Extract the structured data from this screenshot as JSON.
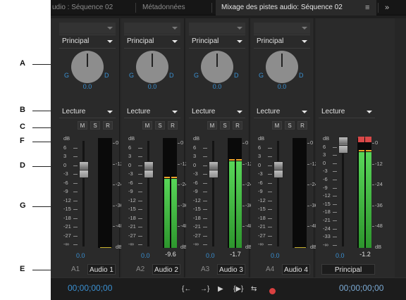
{
  "tabs": [
    {
      "label": "udio : Séquence 02"
    },
    {
      "label": "Métadonnées"
    },
    {
      "label": "Mixage des pistes audio: Séquence 02"
    }
  ],
  "tab_menu_glyph": "≡",
  "tab_overflow_glyph": "»",
  "annotations": [
    "A",
    "B",
    "C",
    "F",
    "D",
    "G",
    "E"
  ],
  "tracks": [
    {
      "output": "Principal",
      "mode": "Lecture",
      "pan_left": "G",
      "pan_right": "D",
      "pan_value": "0.0",
      "mute": "M",
      "solo": "S",
      "record": "R",
      "fader_db": "0.0",
      "peak": "",
      "id": "A1",
      "name": "Audio 1",
      "meter_level": 0.0
    },
    {
      "output": "Principal",
      "mode": "Lecture",
      "pan_left": "G",
      "pan_right": "D",
      "pan_value": "0.0",
      "mute": "M",
      "solo": "S",
      "record": "R",
      "fader_db": "0.0",
      "peak": "-9.6",
      "id": "A2",
      "name": "Audio 2",
      "meter_level": 0.63
    },
    {
      "output": "Principal",
      "mode": "Lecture",
      "pan_left": "G",
      "pan_right": "D",
      "pan_value": "0.0",
      "mute": "M",
      "solo": "S",
      "record": "R",
      "fader_db": "0.0",
      "peak": "-1.7",
      "id": "A3",
      "name": "Audio 3",
      "meter_level": 0.79
    },
    {
      "output": "Principal",
      "mode": "Lecture",
      "pan_left": "G",
      "pan_right": "D",
      "pan_value": "0.0",
      "mute": "M",
      "solo": "S",
      "record": "R",
      "fader_db": "0.0",
      "peak": "",
      "id": "A4",
      "name": "Audio 4",
      "meter_level": 0.0
    }
  ],
  "master": {
    "mode": "Lecture",
    "fader_db": "0.0",
    "peak": "-1.2",
    "name": "Principal",
    "meter_level": 0.87
  },
  "fader_scale": [
    "dB",
    "6",
    "3",
    "0",
    "-3",
    "-6",
    "-9",
    "-12",
    "-15",
    "-18",
    "-21",
    "-27",
    "-∞"
  ],
  "master_fader_scale": [
    "dB",
    "6",
    "3",
    "0",
    "-3",
    "-6",
    "-9",
    "-12",
    "-15",
    "-18",
    "-21",
    "-24",
    "-33",
    "-∞"
  ],
  "meter_scale": [
    "0",
    "-12",
    "-24",
    "-36",
    "-48",
    "dB"
  ],
  "transport": {
    "timecode_left": "00;00;00;00",
    "timecode_right": "00;00;00;00",
    "buttons": [
      "{←",
      "→}",
      "▶",
      "{▶}",
      "⇆"
    ]
  },
  "colors": {
    "accent_blue": "#3a8fd0",
    "meter_green": "#4cc24c",
    "clip_red": "#d94848",
    "record_red": "#d94040"
  }
}
